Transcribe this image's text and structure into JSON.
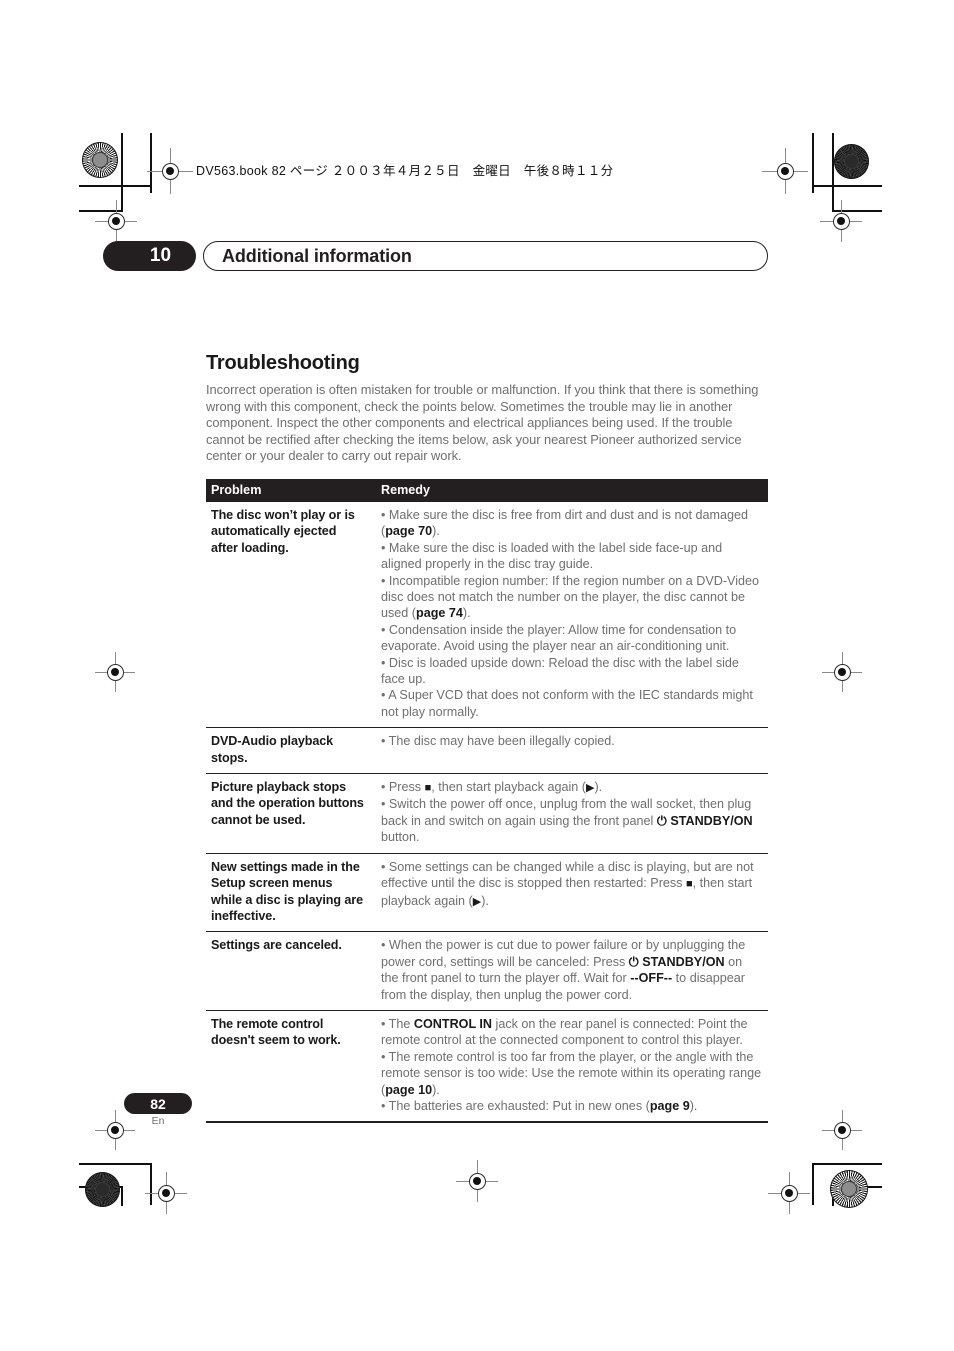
{
  "file_info": "DV563.book  82 ページ  ２００３年４月２５日　金曜日　午後８時１１分",
  "chapter": {
    "number": "10",
    "title": "Additional information"
  },
  "section": {
    "title": "Troubleshooting",
    "intro": "Incorrect operation is often mistaken for trouble or malfunction. If you think that there is something wrong with this component, check the points below. Sometimes the trouble may lie in another component. Inspect the other components and electrical appliances being used. If the trouble cannot be rectified after checking the items below, ask your nearest Pioneer authorized service center or your dealer to carry out repair work."
  },
  "table": {
    "headers": [
      "Problem",
      "Remedy"
    ],
    "rows": [
      {
        "problem": "The disc won’t play or is automatically ejected after loading.",
        "remedy_html": "<span class=\"bullet-line\">• Make sure the disc is free from dirt and dust and is not damaged (<b>page 70</b>).</span><span class=\"bullet-line\">• Make sure the disc is loaded with the label side face-up and aligned properly in the disc tray guide.</span><span class=\"bullet-line\">• Incompatible region number: If the region number on a DVD-Video disc does not match the number on the player, the disc cannot be used (<b>page 74</b>).</span><span class=\"bullet-line\">• Condensation inside the player: Allow time for condensation to evaporate. Avoid using the player near an air-conditioning unit.</span><span class=\"bullet-line\">• Disc is loaded upside down: Reload the disc with the label side face up.</span><span class=\"bullet-line\">• A Super VCD that does not conform with the IEC standards might not play normally.</span>"
      },
      {
        "problem": "DVD-Audio playback stops.",
        "remedy_html": "<span class=\"bullet-line\">• The disc may have been illegally copied.</span>"
      },
      {
        "problem": "Picture playback stops and the operation buttons cannot be used.",
        "remedy_html": "<span class=\"bullet-line\">• Press <span class=\"glyph\">■</span>, then start playback again (<span class=\"glyph\">▶</span>).</span><span class=\"bullet-line\">• Switch the power off once, unplug from the wall socket, then plug back in and switch on again using the front panel <span class=\"pwr\">⏻</span> <b>STANDBY/ON</b> button.</span>"
      },
      {
        "problem": "New settings made in the Setup screen menus while a disc is playing are ineffective.",
        "remedy_html": "<span class=\"bullet-line\">• Some settings can be changed while a disc is playing, but are not effective until the disc is stopped then restarted: Press <span class=\"glyph\">■</span>, then start playback again (<span class=\"glyph\">▶</span>).</span>"
      },
      {
        "problem": "Settings are canceled.",
        "remedy_html": "<span class=\"bullet-line\">• When the power is cut due to power failure or by unplugging the power cord, settings will be canceled: Press <span class=\"pwr\">⏻</span> <b>STANDBY/ON</b> on the front panel to turn the player off. Wait for <b>--OFF--</b> to disappear from the display, then unplug the power cord.</span>"
      },
      {
        "problem": "The remote control doesn't seem to work.",
        "remedy_html": "<span class=\"bullet-line\">• The <b>CONTROL IN</b> jack on the rear panel is connected: Point the remote control at the connected component to control this player.</span><span class=\"bullet-line\">• The remote control is too far from the player, or the angle with the remote sensor is too wide: Use the remote within its operating range (<b>page 10</b>).</span><span class=\"bullet-line\">• The batteries are exhausted: Put in new ones (<b>page 9</b>).</span>"
      }
    ]
  },
  "footer": {
    "page_number": "82",
    "language": "En"
  }
}
